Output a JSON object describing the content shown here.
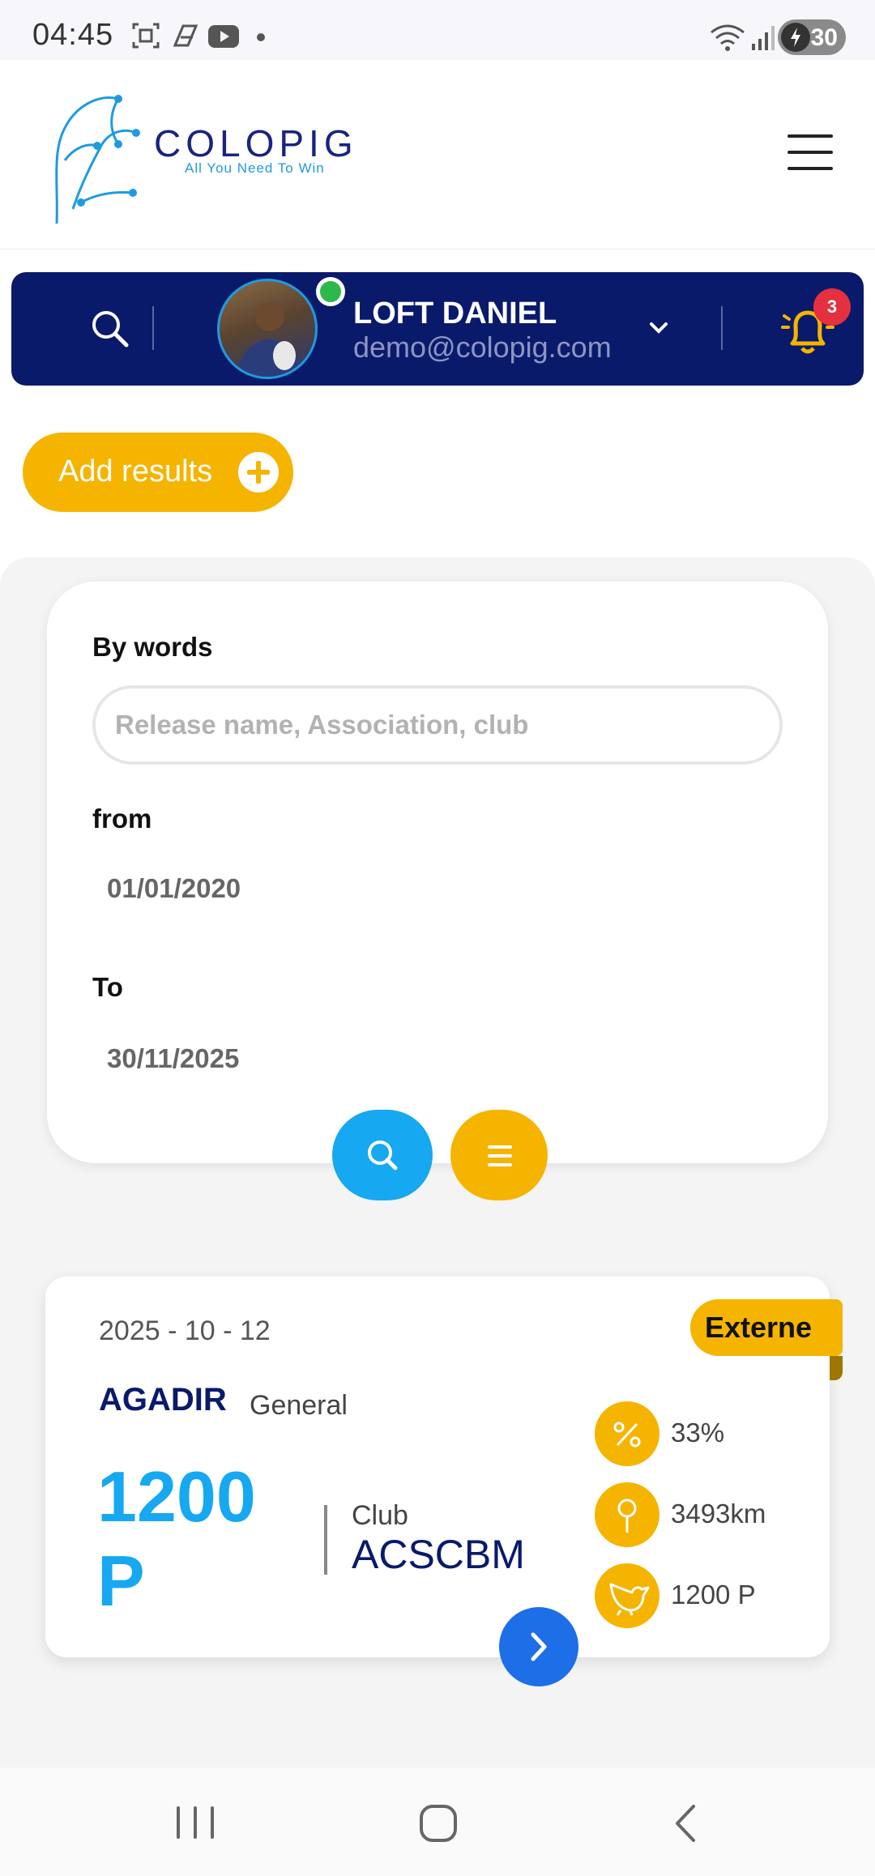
{
  "status_bar": {
    "time": "04:45",
    "battery": "30",
    "icons": [
      "screenshot-icon",
      "app-icon",
      "youtube-icon",
      "dot-icon",
      "wifi-icon",
      "signal-icon",
      "battery-icon"
    ]
  },
  "header": {
    "logo_name": "COLOPIG",
    "logo_tagline": "All You Need To Win",
    "menu_icon": "hamburger-icon"
  },
  "user_bar": {
    "name": "LOFT DANIEL",
    "email": "demo@colopig.com",
    "notification_count": "3",
    "online": true
  },
  "actions": {
    "add_results": "Add results"
  },
  "filter": {
    "words_label": "By words",
    "words_placeholder": "Release name, Association, club",
    "from_label": "from",
    "from_value": "01/01/2020",
    "to_label": "To",
    "to_value": "30/11/2025"
  },
  "results": [
    {
      "date": "2025 - 10 - 12",
      "badge": "Externe",
      "city": "AGADIR",
      "type": "General",
      "points": "1200 P",
      "club_label": "Club",
      "club": "ACSCBM",
      "stats": {
        "percent": "33%",
        "distance": "3493km",
        "birds": "1200 P"
      }
    }
  ],
  "colors": {
    "navy": "#0a1a6b",
    "accent_yellow": "#f5b400",
    "accent_blue": "#16a8f0",
    "next_blue": "#1e6ee8",
    "badge_red": "#e5303f",
    "online_green": "#2eb84a"
  }
}
